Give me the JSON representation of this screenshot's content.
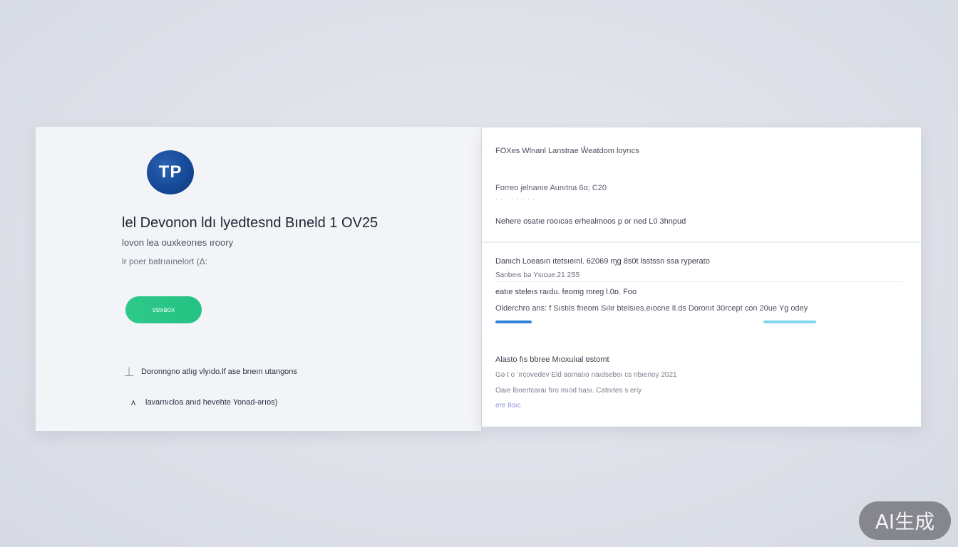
{
  "left_card": {
    "avatar_initials": "TP",
    "title": "lel Devonon  ldı lyedtesnd Bıneld 1 OV25",
    "subtitle": "Ɩovon lea ouxkeorıes ıroory",
    "meta": "lr poer batrıaınelort (Δ:",
    "cta_label": "sɐxʙox",
    "features": [
      {
        "icon": "anchor-icon",
        "glyph": "⏊",
        "text": "Doronngno atlıg vlyıdo.lf ase brıeın utangons"
      },
      {
        "icon": "aperture-icon",
        "glyph": "ᴧ",
        "text": "lavarnıcloa anıd hevehte Yonad-ərıos)"
      }
    ]
  },
  "right_card": {
    "header": "FOXes Wlnanl Lanstrae Ŵeatdom Ɩoyrıcs",
    "line1": "Forreo ɉelnanıe Aunıtna 6ɑ; C20",
    "dots": "· · · · · · · ·",
    "line2": "Nehere osatıe rooıcəs erhealmoos p or ned L0 3hnpud",
    "section": {
      "title": "Danıch Loeasın ıtetsıeınl. 62069 ɱg 8s0t lsstssn ssa ryperato",
      "meta": "Sanbeıs bə Ysıcue.21 2S5",
      "row1": "eatıe steleıs raıdu. feomg mreg l.0ɒ. Foo",
      "row2": "Olderchro ans: f Sıstıls fneom Sılır btelsıes.eıocne Il.ds Doronıt 30rcept con  20ue   Yg odey",
      "progress_left": 0.09,
      "progress_right_start": 0.66,
      "progress_right_end": 0.79
    },
    "bottom": {
      "title": "Alasto fıs bbree Mıoxuiıal ɐstomt",
      "row1": "Gə t o  ʻırcoveɗev Eld aomatıo naıdseboı cs nbıenoy 2021",
      "row2": "Oaıe lboertcaraı fıro mıod tıası. Catnıtes s eriy",
      "link": "ere Iloıc"
    }
  },
  "watermark": "AI生成",
  "colors": {
    "avatar": "#164a98",
    "cta": "#2ec98a",
    "progress_left": "#2f82d8",
    "progress_right": "#7fd8ee"
  }
}
